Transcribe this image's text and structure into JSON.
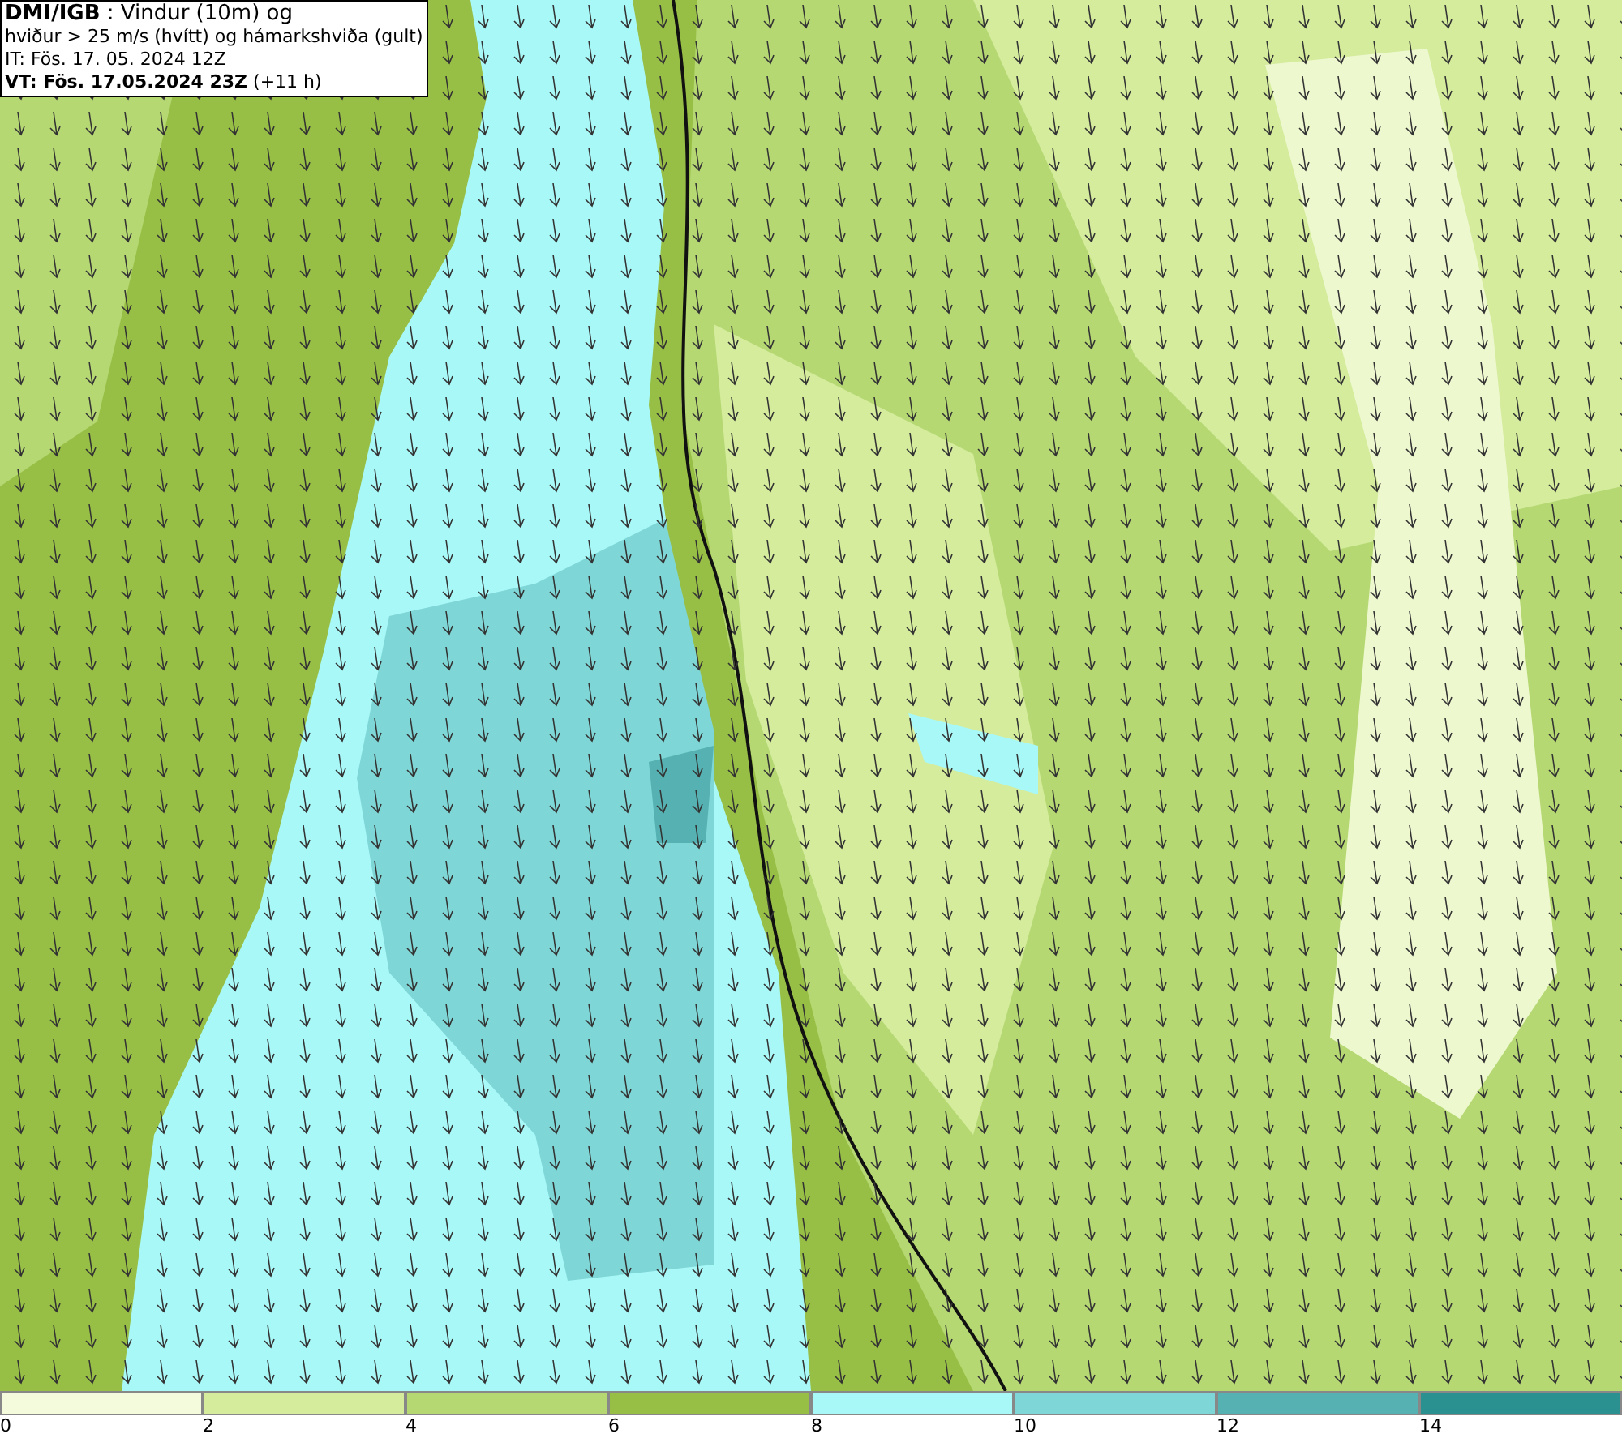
{
  "info_box": {
    "lines": [
      "**DMI/IGB** : Vindur (10m) og",
      "hviður > 25 m/s (hvítt) og hámarkshviða (gult)",
      "IT: Fös. 17. 05. 2024 12Z",
      "**VT: Fös. 17.05.2024 23Z** (+11 h)"
    ]
  },
  "legend": {
    "bins": [
      {
        "label": "0",
        "color": "#f4fbdc"
      },
      {
        "label": "2",
        "color": "#d4ec9c"
      },
      {
        "label": "4",
        "color": "#b5d873"
      },
      {
        "label": "6",
        "color": "#98bf45"
      },
      {
        "label": "8",
        "color": "#a9f8f8"
      },
      {
        "label": "10",
        "color": "#7fd6d6"
      },
      {
        "label": "12",
        "color": "#56b2b2"
      },
      {
        "label": "14",
        "color": "#2a9090"
      }
    ]
  }
}
